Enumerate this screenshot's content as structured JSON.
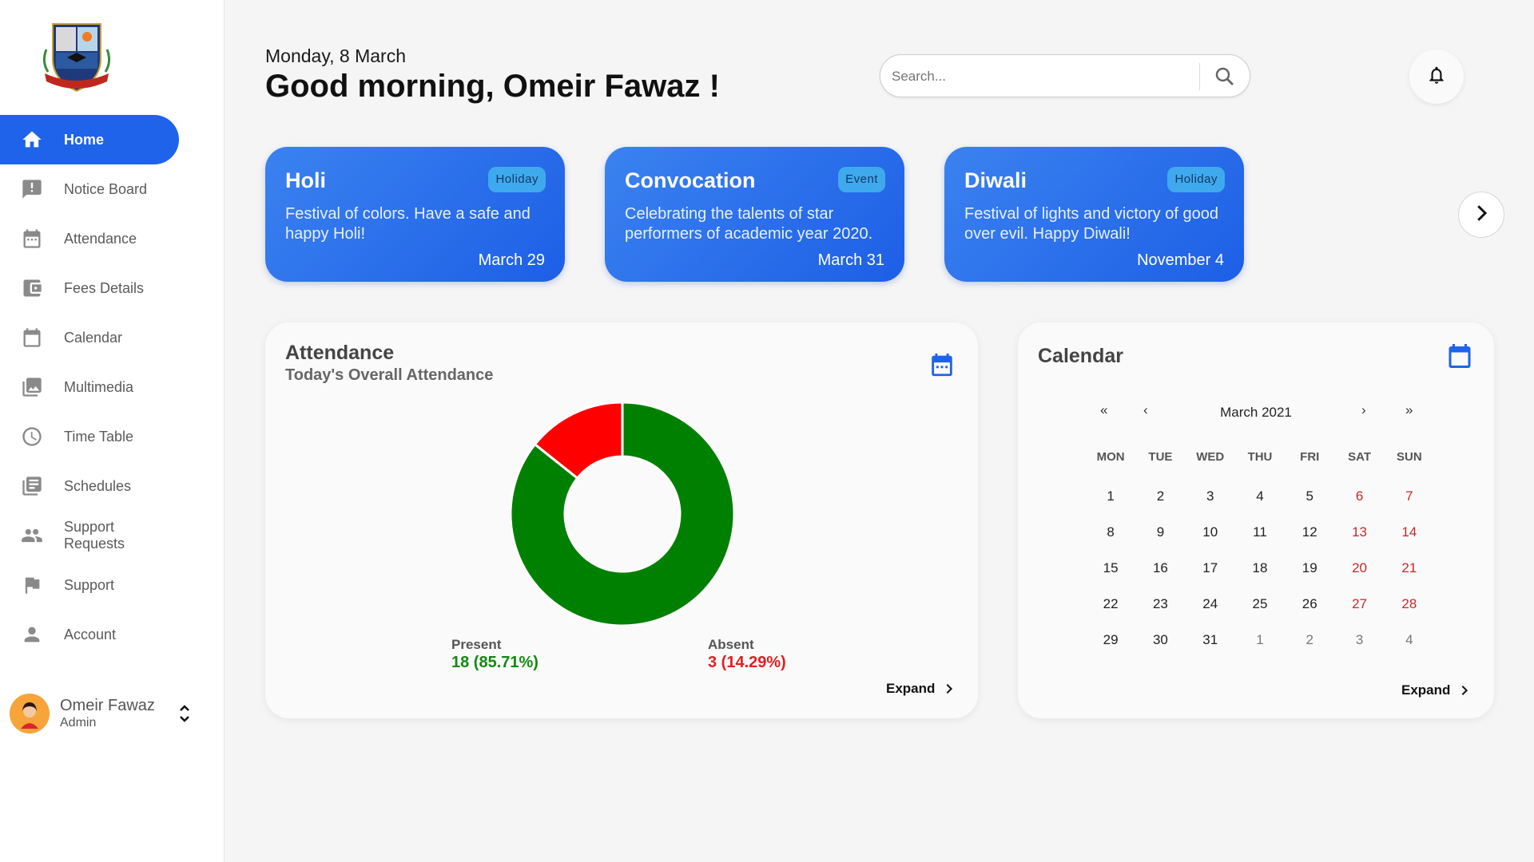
{
  "app": {
    "logo_icon": "school-crest-logo"
  },
  "sidebar": {
    "items": [
      {
        "label": "Home",
        "icon": "home-icon"
      },
      {
        "label": "Notice Board",
        "icon": "notice-icon"
      },
      {
        "label": "Attendance",
        "icon": "attendance-calendar-icon"
      },
      {
        "label": "Fees Details",
        "icon": "wallet-icon"
      },
      {
        "label": "Calendar",
        "icon": "calendar-icon"
      },
      {
        "label": "Multimedia",
        "icon": "photo-library-icon"
      },
      {
        "label": "Time Table",
        "icon": "clock-icon"
      },
      {
        "label": "Schedules",
        "icon": "library-books-icon"
      },
      {
        "label": "Support Requests",
        "label_line1": "Support",
        "label_line2": "Requests",
        "icon": "people-icon"
      },
      {
        "label": "Support",
        "icon": "flag-icon"
      },
      {
        "label": "Account",
        "icon": "person-icon"
      }
    ],
    "active": "Home",
    "user": {
      "name": "Omeir Fawaz",
      "role": "Admin"
    }
  },
  "header": {
    "date": "Monday, 8 March",
    "greeting": "Good morning, Omeir Fawaz !"
  },
  "search": {
    "placeholder": "Search...",
    "value": ""
  },
  "events": [
    {
      "title": "Holi",
      "badge": "Holiday",
      "description": "Festival of colors. Have a safe and happy Holi!",
      "date": "March 29"
    },
    {
      "title": "Convocation",
      "badge": "Event",
      "description": "Celebrating the talents of star performers of academic year 2020.",
      "date": "March 31"
    },
    {
      "title": "Diwali",
      "badge": "Holiday",
      "description": "Festival of lights and victory of good over evil. Happy Diwali!",
      "date": "November 4"
    }
  ],
  "attendance": {
    "title": "Attendance",
    "subtitle": "Today's Overall Attendance",
    "present_label": "Present",
    "present_value": "18 (85.71%)",
    "absent_label": "Absent",
    "absent_value": "3 (14.29%)",
    "expand_label": "Expand"
  },
  "chart_data": {
    "type": "pie",
    "categories": [
      "Present",
      "Absent"
    ],
    "values": [
      18,
      3
    ],
    "colors": [
      "#008000",
      "#ff0000"
    ],
    "title": "",
    "hole": true
  },
  "calendar": {
    "title": "Calendar",
    "month_label": "March 2021",
    "nav": {
      "first": "«",
      "prev": "‹",
      "next": "›",
      "last": "»"
    },
    "weekdays": [
      "MON",
      "TUE",
      "WED",
      "THU",
      "FRI",
      "SAT",
      "SUN"
    ],
    "weeks": [
      [
        "1",
        "2",
        "3",
        "4",
        "5",
        "6",
        "7"
      ],
      [
        "8",
        "9",
        "10",
        "11",
        "12",
        "13",
        "14"
      ],
      [
        "15",
        "16",
        "17",
        "18",
        "19",
        "20",
        "21"
      ],
      [
        "22",
        "23",
        "24",
        "25",
        "26",
        "27",
        "28"
      ],
      [
        "29",
        "30",
        "31",
        "1",
        "2",
        "3",
        "4"
      ]
    ],
    "today": "8",
    "highlight_color": "#f7f768",
    "weekend_color": "#c62828",
    "expand_label": "Expand"
  },
  "colors": {
    "accent": "#1e63e9",
    "present": "#008000",
    "absent": "#ff0000"
  }
}
